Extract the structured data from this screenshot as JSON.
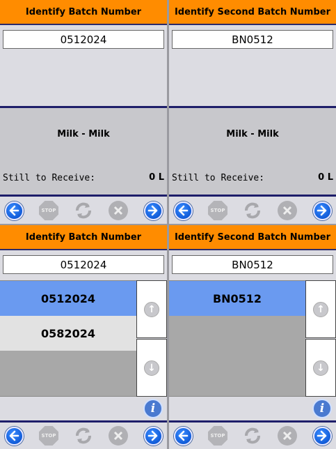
{
  "panels": {
    "tl": {
      "title": "Identify Batch Number",
      "value": "0512024",
      "product": "Milk - Milk",
      "still_label": "Still to Receive:",
      "still_value": "0 L"
    },
    "tr": {
      "title": "Identify Second Batch Number",
      "value": "BN0512",
      "product": "Milk - Milk",
      "still_label": "Still to Receive:",
      "still_value": "0 L"
    },
    "bl": {
      "title": "Identify Batch Number",
      "value": "0512024",
      "list": [
        "0512024",
        "0582024"
      ]
    },
    "br": {
      "title": "Identify Second Batch Number",
      "value": "BN0512",
      "list": [
        "BN0512"
      ]
    }
  },
  "toolbar": {
    "stop_label": "STOP"
  },
  "icons": {
    "back": "back-arrow-icon",
    "stop": "stop-icon",
    "refresh": "refresh-icon",
    "cancel": "cancel-icon",
    "next": "next-arrow-icon",
    "info": "info-icon",
    "up": "up-arrow-icon",
    "down": "down-arrow-icon"
  },
  "colors": {
    "header": "#ff8c00",
    "selected": "#6a9af0",
    "accent": "#1e1e6a"
  }
}
